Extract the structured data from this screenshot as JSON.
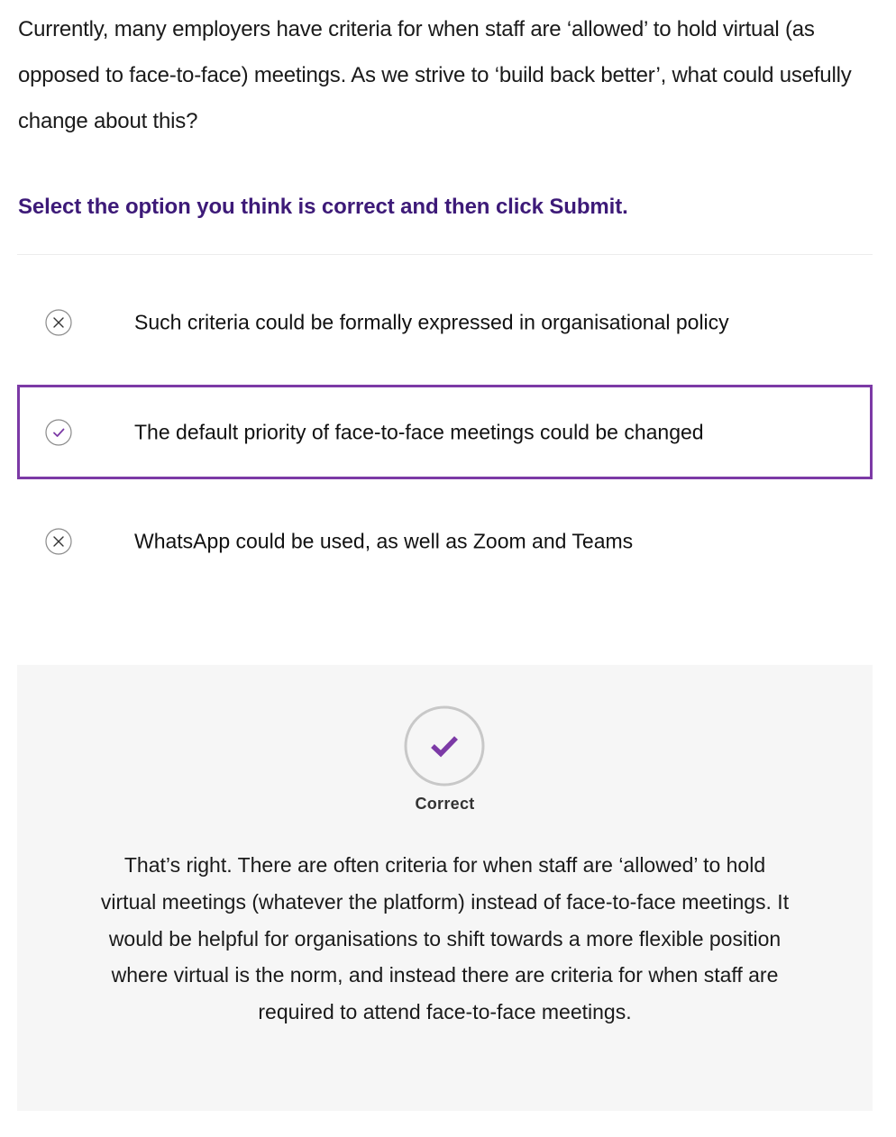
{
  "question": {
    "text": "Currently, many employers have criteria for when staff are ‘allowed’ to hold virtual (as opposed to face-to-face) meetings. As we strive to ‘build back better’, what could usefully change about this?"
  },
  "instruction": {
    "text": "Select the option you think is correct and then click Submit."
  },
  "options": [
    {
      "label": "Such criteria could be formally expressed in organisational policy",
      "icon": "cross-circle-icon",
      "selected": false,
      "correct": false
    },
    {
      "label": "The default priority of face-to-face meetings could be changed",
      "icon": "check-circle-icon",
      "selected": true,
      "correct": true
    },
    {
      "label": "WhatsApp could be used, as well as Zoom and Teams",
      "icon": "cross-circle-icon",
      "selected": false,
      "correct": false
    }
  ],
  "feedback": {
    "status": "Correct",
    "icon": "check-badge-icon",
    "text": "That’s right.  There are often criteria for when staff are ‘allowed’ to hold virtual meetings (whatever the platform) instead of face-to-face meetings. It would be helpful for organisations to shift towards a more flexible position where virtual is the norm, and instead there are criteria for when staff are required to attend face-to-face meetings."
  },
  "colors": {
    "accent": "#7c3aa6",
    "instruction": "#3d1a78",
    "feedback_bg": "#f6f6f6",
    "icon_gray": "#8a8a8a"
  }
}
